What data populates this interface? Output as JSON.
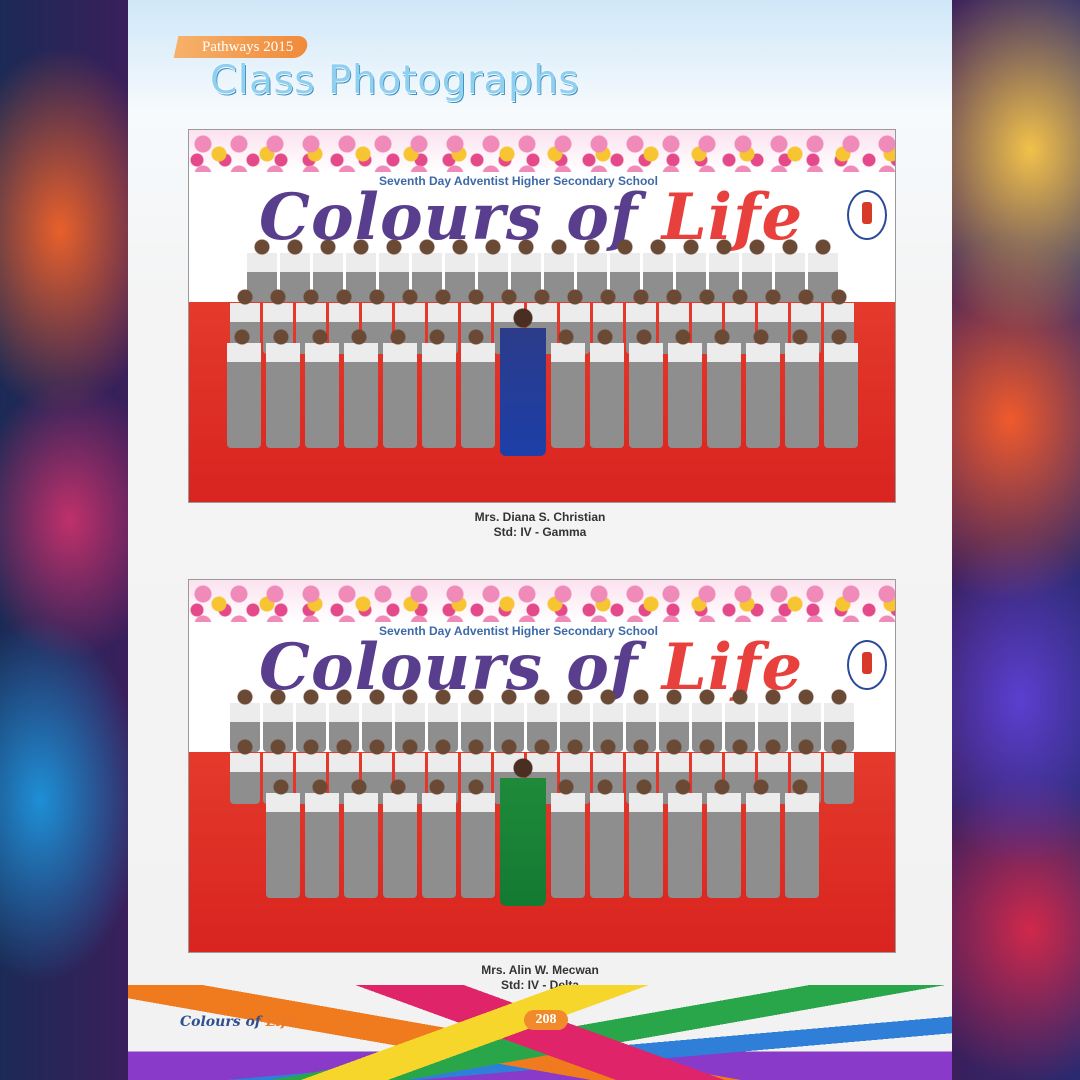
{
  "header": {
    "series": "Pathways 2015",
    "title": "Class Photographs"
  },
  "photos": [
    {
      "school": "Seventh Day Adventist Higher Secondary School",
      "backdrop_word_a": "Colours of",
      "backdrop_word_b": "Life",
      "teacher": "Mrs. Diana S. Christian",
      "class": "Std: IV - Gamma",
      "teacher_outfit_color": "#1c3fa8"
    },
    {
      "school": "Seventh Day Adventist Higher Secondary School",
      "backdrop_word_a": "Colours of",
      "backdrop_word_b": "Life",
      "teacher": "Mrs. Alin W. Mecwan",
      "class": "Std: IV - Delta",
      "teacher_outfit_color": "#127a32"
    }
  ],
  "footer": {
    "brand_a": "Colours of",
    "brand_b": "Life",
    "page_number": "208"
  },
  "colors": {
    "accent_orange": "#f08a2a",
    "title_blue": "#8fd0f0",
    "stage_red": "#d9241f"
  }
}
